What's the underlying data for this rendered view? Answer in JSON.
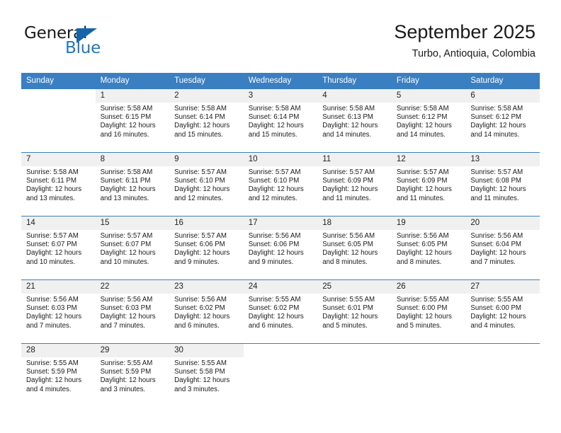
{
  "brand": {
    "name_part1": "General",
    "name_part2": "Blue",
    "triangle_color": "#1464aa",
    "blue_text_color": "#2277bb"
  },
  "header": {
    "month_title": "September 2025",
    "location": "Turbo, Antioquia, Colombia"
  },
  "theme": {
    "header_bg": "#3a7fc1",
    "daynum_bg": "#f0f0f0",
    "text": "#1a1a1a"
  },
  "weekday_headers": [
    "Sunday",
    "Monday",
    "Tuesday",
    "Wednesday",
    "Thursday",
    "Friday",
    "Saturday"
  ],
  "labels": {
    "sunrise_prefix": "Sunrise:",
    "sunset_prefix": "Sunset:",
    "daylight_prefix": "Daylight:"
  },
  "weeks": [
    [
      {
        "day": "",
        "blank": true,
        "line1": "",
        "line2": "",
        "line3": "",
        "line4": ""
      },
      {
        "day": "1",
        "line1": "Sunrise: 5:58 AM",
        "line2": "Sunset: 6:15 PM",
        "line3": "Daylight: 12 hours",
        "line4": "and 16 minutes."
      },
      {
        "day": "2",
        "line1": "Sunrise: 5:58 AM",
        "line2": "Sunset: 6:14 PM",
        "line3": "Daylight: 12 hours",
        "line4": "and 15 minutes."
      },
      {
        "day": "3",
        "line1": "Sunrise: 5:58 AM",
        "line2": "Sunset: 6:14 PM",
        "line3": "Daylight: 12 hours",
        "line4": "and 15 minutes."
      },
      {
        "day": "4",
        "line1": "Sunrise: 5:58 AM",
        "line2": "Sunset: 6:13 PM",
        "line3": "Daylight: 12 hours",
        "line4": "and 14 minutes."
      },
      {
        "day": "5",
        "line1": "Sunrise: 5:58 AM",
        "line2": "Sunset: 6:12 PM",
        "line3": "Daylight: 12 hours",
        "line4": "and 14 minutes."
      },
      {
        "day": "6",
        "line1": "Sunrise: 5:58 AM",
        "line2": "Sunset: 6:12 PM",
        "line3": "Daylight: 12 hours",
        "line4": "and 14 minutes."
      }
    ],
    [
      {
        "day": "7",
        "line1": "Sunrise: 5:58 AM",
        "line2": "Sunset: 6:11 PM",
        "line3": "Daylight: 12 hours",
        "line4": "and 13 minutes."
      },
      {
        "day": "8",
        "line1": "Sunrise: 5:58 AM",
        "line2": "Sunset: 6:11 PM",
        "line3": "Daylight: 12 hours",
        "line4": "and 13 minutes."
      },
      {
        "day": "9",
        "line1": "Sunrise: 5:57 AM",
        "line2": "Sunset: 6:10 PM",
        "line3": "Daylight: 12 hours",
        "line4": "and 12 minutes."
      },
      {
        "day": "10",
        "line1": "Sunrise: 5:57 AM",
        "line2": "Sunset: 6:10 PM",
        "line3": "Daylight: 12 hours",
        "line4": "and 12 minutes."
      },
      {
        "day": "11",
        "line1": "Sunrise: 5:57 AM",
        "line2": "Sunset: 6:09 PM",
        "line3": "Daylight: 12 hours",
        "line4": "and 11 minutes."
      },
      {
        "day": "12",
        "line1": "Sunrise: 5:57 AM",
        "line2": "Sunset: 6:09 PM",
        "line3": "Daylight: 12 hours",
        "line4": "and 11 minutes."
      },
      {
        "day": "13",
        "line1": "Sunrise: 5:57 AM",
        "line2": "Sunset: 6:08 PM",
        "line3": "Daylight: 12 hours",
        "line4": "and 11 minutes."
      }
    ],
    [
      {
        "day": "14",
        "line1": "Sunrise: 5:57 AM",
        "line2": "Sunset: 6:07 PM",
        "line3": "Daylight: 12 hours",
        "line4": "and 10 minutes."
      },
      {
        "day": "15",
        "line1": "Sunrise: 5:57 AM",
        "line2": "Sunset: 6:07 PM",
        "line3": "Daylight: 12 hours",
        "line4": "and 10 minutes."
      },
      {
        "day": "16",
        "line1": "Sunrise: 5:57 AM",
        "line2": "Sunset: 6:06 PM",
        "line3": "Daylight: 12 hours",
        "line4": "and 9 minutes."
      },
      {
        "day": "17",
        "line1": "Sunrise: 5:56 AM",
        "line2": "Sunset: 6:06 PM",
        "line3": "Daylight: 12 hours",
        "line4": "and 9 minutes."
      },
      {
        "day": "18",
        "line1": "Sunrise: 5:56 AM",
        "line2": "Sunset: 6:05 PM",
        "line3": "Daylight: 12 hours",
        "line4": "and 8 minutes."
      },
      {
        "day": "19",
        "line1": "Sunrise: 5:56 AM",
        "line2": "Sunset: 6:05 PM",
        "line3": "Daylight: 12 hours",
        "line4": "and 8 minutes."
      },
      {
        "day": "20",
        "line1": "Sunrise: 5:56 AM",
        "line2": "Sunset: 6:04 PM",
        "line3": "Daylight: 12 hours",
        "line4": "and 7 minutes."
      }
    ],
    [
      {
        "day": "21",
        "line1": "Sunrise: 5:56 AM",
        "line2": "Sunset: 6:03 PM",
        "line3": "Daylight: 12 hours",
        "line4": "and 7 minutes."
      },
      {
        "day": "22",
        "line1": "Sunrise: 5:56 AM",
        "line2": "Sunset: 6:03 PM",
        "line3": "Daylight: 12 hours",
        "line4": "and 7 minutes."
      },
      {
        "day": "23",
        "line1": "Sunrise: 5:56 AM",
        "line2": "Sunset: 6:02 PM",
        "line3": "Daylight: 12 hours",
        "line4": "and 6 minutes."
      },
      {
        "day": "24",
        "line1": "Sunrise: 5:55 AM",
        "line2": "Sunset: 6:02 PM",
        "line3": "Daylight: 12 hours",
        "line4": "and 6 minutes."
      },
      {
        "day": "25",
        "line1": "Sunrise: 5:55 AM",
        "line2": "Sunset: 6:01 PM",
        "line3": "Daylight: 12 hours",
        "line4": "and 5 minutes."
      },
      {
        "day": "26",
        "line1": "Sunrise: 5:55 AM",
        "line2": "Sunset: 6:00 PM",
        "line3": "Daylight: 12 hours",
        "line4": "and 5 minutes."
      },
      {
        "day": "27",
        "line1": "Sunrise: 5:55 AM",
        "line2": "Sunset: 6:00 PM",
        "line3": "Daylight: 12 hours",
        "line4": "and 4 minutes."
      }
    ],
    [
      {
        "day": "28",
        "line1": "Sunrise: 5:55 AM",
        "line2": "Sunset: 5:59 PM",
        "line3": "Daylight: 12 hours",
        "line4": "and 4 minutes."
      },
      {
        "day": "29",
        "line1": "Sunrise: 5:55 AM",
        "line2": "Sunset: 5:59 PM",
        "line3": "Daylight: 12 hours",
        "line4": "and 3 minutes."
      },
      {
        "day": "30",
        "line1": "Sunrise: 5:55 AM",
        "line2": "Sunset: 5:58 PM",
        "line3": "Daylight: 12 hours",
        "line4": "and 3 minutes."
      },
      {
        "day": "",
        "blank": true,
        "line1": "",
        "line2": "",
        "line3": "",
        "line4": ""
      },
      {
        "day": "",
        "blank": true,
        "line1": "",
        "line2": "",
        "line3": "",
        "line4": ""
      },
      {
        "day": "",
        "blank": true,
        "line1": "",
        "line2": "",
        "line3": "",
        "line4": ""
      },
      {
        "day": "",
        "blank": true,
        "line1": "",
        "line2": "",
        "line3": "",
        "line4": ""
      }
    ]
  ]
}
